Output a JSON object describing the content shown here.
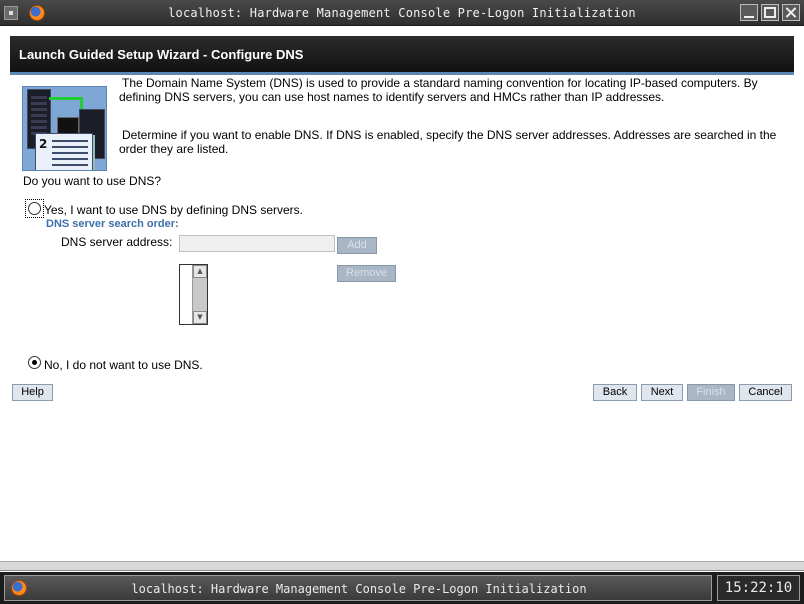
{
  "window": {
    "title": "localhost: Hardware Management Console Pre-Logon Initialization"
  },
  "header": {
    "title": "Launch Guided Setup Wizard - Configure DNS"
  },
  "intro": {
    "paragraph1": "The Domain Name System (DNS) is used to provide a standard naming convention for locating IP-based computers. By defining DNS servers, you can use host names to identify servers and HMCs rather than IP addresses.",
    "paragraph2": "Determine if you want to enable DNS. If DNS is enabled, specify the DNS server addresses. Addresses are searched in the order they are listed."
  },
  "question": "Do you want to use DNS?",
  "options": {
    "yes_label": "Yes, I want to use DNS by defining DNS servers.",
    "yes_selected": false,
    "no_label": "No, I do not want to use DNS.",
    "no_selected": true
  },
  "dns": {
    "search_order_title": "DNS server search order:",
    "address_label": "DNS server address:",
    "address_value": "",
    "add_label": "Add",
    "remove_label": "Remove",
    "servers": []
  },
  "footer": {
    "help_label": "Help",
    "back_label": "Back",
    "next_label": "Next",
    "finish_label": "Finish",
    "cancel_label": "Cancel"
  },
  "taskbar": {
    "task_label": "localhost: Hardware Management Console Pre-Logon Initialization",
    "clock": "15:22:10"
  },
  "icons": {
    "app": "firefox-icon",
    "system_menu": "window-menu-icon",
    "illustration": "dns-servers-illustration"
  },
  "colors": {
    "header_bg": "#1c1c1c",
    "header_rule": "#5a88b0",
    "section_title": "#3d6fa8",
    "button_bg": "#dfe6ee",
    "disabled_button_bg": "#a9b6c6"
  }
}
